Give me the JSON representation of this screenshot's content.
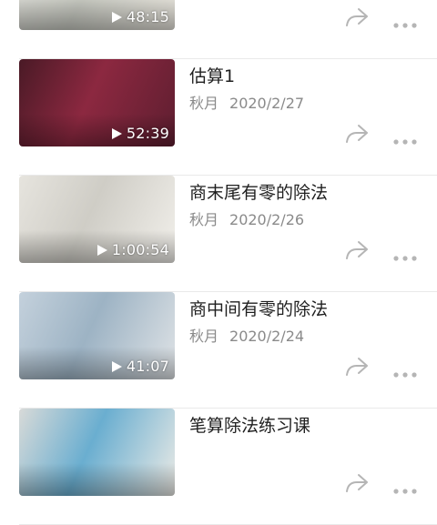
{
  "videos": [
    {
      "title": "",
      "author": "",
      "date": "",
      "duration": "48:15",
      "thumb_colors": [
        "#dcdcd6",
        "#c6c8c0",
        "#e7e4dc"
      ]
    },
    {
      "title": "估算1",
      "author": "秋月",
      "date": "2020/2/27",
      "duration": "52:39",
      "thumb_colors": [
        "#4a1a26",
        "#8c2840",
        "#5e1e30"
      ]
    },
    {
      "title": "商末尾有零的除法",
      "author": "秋月",
      "date": "2020/2/26",
      "duration": "1:00:54",
      "thumb_colors": [
        "#e6e4de",
        "#cfcdc6",
        "#f1efea"
      ]
    },
    {
      "title": "商中间有零的除法",
      "author": "秋月",
      "date": "2020/2/24",
      "duration": "41:07",
      "thumb_colors": [
        "#c4d1dc",
        "#9db3c4",
        "#dfe3e6"
      ]
    },
    {
      "title": "笔算除法练习课",
      "author": "",
      "date": "",
      "duration": "",
      "thumb_colors": [
        "#d8dad8",
        "#6aaed0",
        "#ecebe6"
      ]
    }
  ],
  "icons": {
    "share": "share-icon",
    "more": "more-icon",
    "play": "play-icon"
  },
  "colors": {
    "title_text": "#1f1f1f",
    "meta_text": "#8a8a8a",
    "icon": "#b5b5b5",
    "divider": "#e9e9e9"
  }
}
